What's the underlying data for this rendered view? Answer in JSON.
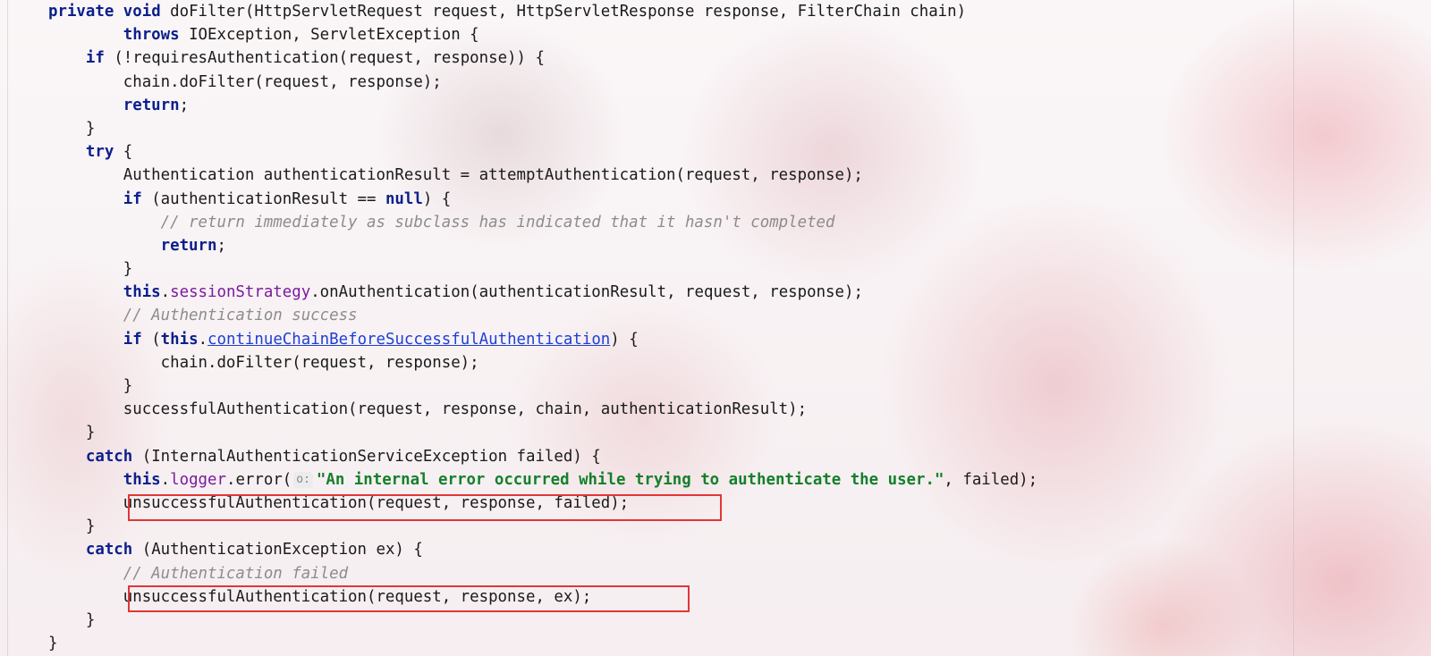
{
  "editor": {
    "lines": [
      {
        "segments": [
          {
            "t": "private",
            "c": "kw"
          },
          {
            "t": " "
          },
          {
            "t": "void",
            "c": "kw"
          },
          {
            "t": " doFilter(HttpServletRequest request, HttpServletResponse response, FilterChain chain)"
          }
        ]
      },
      {
        "segments": [
          {
            "t": "        "
          },
          {
            "t": "throws",
            "c": "kw"
          },
          {
            "t": " IOException, ServletException {"
          }
        ]
      },
      {
        "segments": [
          {
            "t": "    "
          },
          {
            "t": "if",
            "c": "kw"
          },
          {
            "t": " (!requiresAuthentication(request, response)) {"
          }
        ]
      },
      {
        "segments": [
          {
            "t": "        chain.doFilter(request, response);"
          }
        ]
      },
      {
        "segments": [
          {
            "t": "        "
          },
          {
            "t": "return",
            "c": "kw"
          },
          {
            "t": ";"
          }
        ]
      },
      {
        "segments": [
          {
            "t": "    }"
          }
        ]
      },
      {
        "segments": [
          {
            "t": "    "
          },
          {
            "t": "try",
            "c": "kw"
          },
          {
            "t": " {"
          }
        ]
      },
      {
        "segments": [
          {
            "t": "        Authentication authenticationResult = attemptAuthentication(request, response);"
          }
        ]
      },
      {
        "segments": [
          {
            "t": "        "
          },
          {
            "t": "if",
            "c": "kw"
          },
          {
            "t": " (authenticationResult == "
          },
          {
            "t": "null",
            "c": "kw"
          },
          {
            "t": ") {"
          }
        ]
      },
      {
        "segments": [
          {
            "t": "            "
          },
          {
            "t": "// return immediately as subclass has indicated that it hasn't completed",
            "c": "cm"
          }
        ]
      },
      {
        "segments": [
          {
            "t": "            "
          },
          {
            "t": "return",
            "c": "kw"
          },
          {
            "t": ";"
          }
        ]
      },
      {
        "segments": [
          {
            "t": "        }"
          }
        ]
      },
      {
        "segments": [
          {
            "t": "        "
          },
          {
            "t": "this",
            "c": "kw"
          },
          {
            "t": "."
          },
          {
            "t": "sessionStrategy",
            "c": "field"
          },
          {
            "t": ".onAuthentication(authenticationResult, request, response);"
          }
        ]
      },
      {
        "segments": [
          {
            "t": "        "
          },
          {
            "t": "// Authentication success",
            "c": "cm"
          }
        ]
      },
      {
        "segments": [
          {
            "t": "        "
          },
          {
            "t": "if",
            "c": "kw"
          },
          {
            "t": " ("
          },
          {
            "t": "this",
            "c": "kw"
          },
          {
            "t": "."
          },
          {
            "t": "continueChainBeforeSuccessfulAuthentication",
            "c": "link"
          },
          {
            "t": ") {"
          }
        ]
      },
      {
        "segments": [
          {
            "t": "            chain.doFilter(request, response);"
          }
        ]
      },
      {
        "segments": [
          {
            "t": "        }"
          }
        ]
      },
      {
        "segments": [
          {
            "t": "        successfulAuthentication(request, response, chain, authenticationResult);"
          }
        ]
      },
      {
        "segments": [
          {
            "t": "    }"
          }
        ]
      },
      {
        "segments": [
          {
            "t": "    "
          },
          {
            "t": "catch",
            "c": "kw"
          },
          {
            "t": " (InternalAuthenticationServiceException failed) {"
          }
        ]
      },
      {
        "segments": [
          {
            "t": "        "
          },
          {
            "t": "this",
            "c": "kw"
          },
          {
            "t": "."
          },
          {
            "t": "logger",
            "c": "field"
          },
          {
            "t": ".error("
          },
          {
            "t": "o:",
            "c": "hint"
          },
          {
            "t": "\"An internal error occurred while trying to authenticate the user.\"",
            "c": "str"
          },
          {
            "t": ", failed);"
          }
        ]
      },
      {
        "segments": [
          {
            "t": "        unsuccessfulAuthentication(request, response, failed);"
          }
        ]
      },
      {
        "segments": [
          {
            "t": "    }"
          }
        ]
      },
      {
        "segments": [
          {
            "t": "    "
          },
          {
            "t": "catch",
            "c": "kw"
          },
          {
            "t": " (AuthenticationException ex) {"
          }
        ]
      },
      {
        "segments": [
          {
            "t": "        "
          },
          {
            "t": "// Authentication failed",
            "c": "cm"
          }
        ]
      },
      {
        "segments": [
          {
            "t": "        unsuccessfulAuthentication(request, response, ex);"
          }
        ]
      },
      {
        "segments": [
          {
            "t": "    }"
          }
        ]
      },
      {
        "segments": [
          {
            "t": "}"
          }
        ]
      }
    ]
  },
  "colors": {
    "keyword": "#0b1f8c",
    "field": "#7a1aa0",
    "link": "#1d3fd6",
    "comment": "#8c8c8c",
    "string": "#13802b",
    "highlight_box": "#e23636"
  }
}
